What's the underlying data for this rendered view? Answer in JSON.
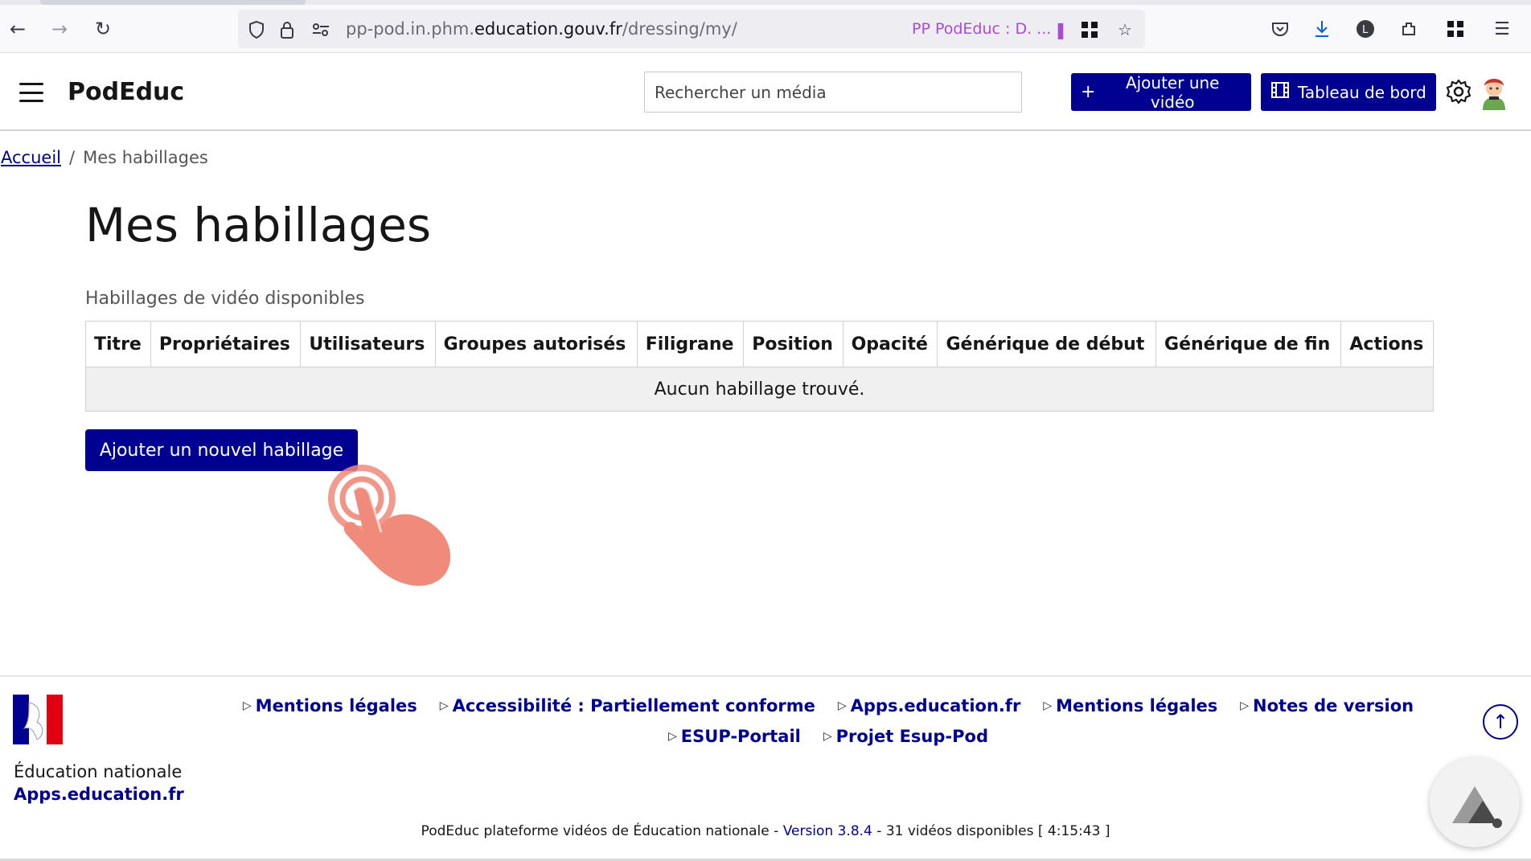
{
  "browser": {
    "url_prefix": "pp-pod.in.phm.",
    "url_domain": "education.gouv.fr",
    "url_path": "/dressing/my/",
    "tab_hint": "PP PodEduc : D. ..."
  },
  "header": {
    "brand": "PodEduc",
    "search_placeholder": "Rechercher un média",
    "add_video_label": "Ajouter une vidéo",
    "dashboard_label": "Tableau de bord"
  },
  "breadcrumb": {
    "home": "Accueil",
    "separator": "/",
    "current": "Mes habillages"
  },
  "main": {
    "title": "Mes habillages",
    "caption": "Habillages de vidéo disponibles",
    "columns": [
      "Titre",
      "Propriétaires",
      "Utilisateurs",
      "Groupes autorisés",
      "Filigrane",
      "Position",
      "Opacité",
      "Générique de début",
      "Générique de fin",
      "Actions"
    ],
    "empty_message": "Aucun habillage trouvé.",
    "add_button": "Ajouter un nouvel habillage"
  },
  "footer": {
    "ministry": "Éducation nationale",
    "ministry_link": "Apps.education.fr",
    "links": [
      "Mentions légales",
      "Accessibilité : Partiellement conforme",
      "Apps.education.fr",
      "Mentions légales",
      "Notes de version",
      "ESUP-Portail",
      "Projet Esup-Pod"
    ],
    "bottom_prefix": "PodEduc plateforme vidéos de Éducation nationale - ",
    "version": "Version 3.8.4",
    "bottom_suffix": " - 31 vidéos disponibles [ 4:15:43 ]"
  },
  "colors": {
    "primary": "#000091",
    "hand": "#f08a7a"
  },
  "icons": [
    "back-arrow-icon",
    "forward-arrow-icon",
    "reload-icon",
    "shield-icon",
    "lock-icon",
    "permissions-icon",
    "bookmark-star-icon",
    "pocket-icon",
    "download-icon",
    "account-icon",
    "extensions-icon",
    "apps-grid-icon",
    "menu-icon",
    "gear-icon",
    "arrow-up-icon",
    "tap-hand-icon"
  ]
}
